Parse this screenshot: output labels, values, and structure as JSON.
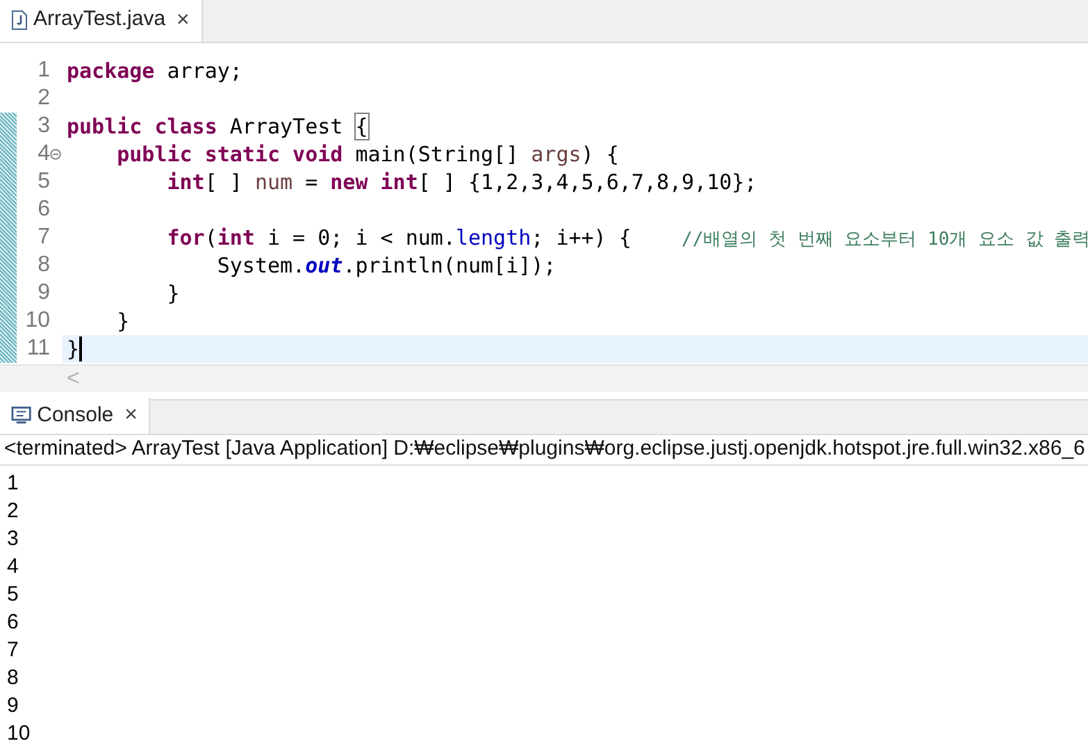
{
  "editor_tab": {
    "title": "ArrayTest.java",
    "close": "×"
  },
  "editor": {
    "lines": [
      {
        "number": "1",
        "changed": false,
        "current": false,
        "fold": false,
        "tokens": [
          {
            "kind": "keyword",
            "text": "package"
          },
          {
            "kind": "plain",
            "text": " array;"
          }
        ]
      },
      {
        "number": "2",
        "changed": false,
        "current": false,
        "fold": false
      },
      {
        "number": "3",
        "changed": true,
        "current": false,
        "fold": false,
        "tokens": [
          {
            "kind": "keyword",
            "text": "public"
          },
          {
            "kind": "keyword",
            "text": " class"
          },
          {
            "kind": "plain",
            "text": " ArrayTest "
          },
          {
            "kind": "matched_bracket",
            "text": "{"
          }
        ]
      },
      {
        "number": "4",
        "changed": true,
        "current": false,
        "fold": true,
        "tokens": [
          {
            "kind": "keyword",
            "text": "    public"
          },
          {
            "kind": "keyword",
            "text": " static"
          },
          {
            "kind": "keyword",
            "text": " void"
          },
          {
            "kind": "plain",
            "text": " main(String[] "
          },
          {
            "kind": "variable",
            "text": "args"
          },
          {
            "kind": "plain",
            "text": ") {"
          }
        ]
      },
      {
        "number": "5",
        "changed": true,
        "current": false,
        "fold": false,
        "tokens": [
          {
            "kind": "keyword",
            "text": "        int"
          },
          {
            "kind": "plain",
            "text": "[ ] "
          },
          {
            "kind": "variable",
            "text": "num"
          },
          {
            "kind": "plain",
            "text": " = "
          },
          {
            "kind": "keyword",
            "text": "new"
          },
          {
            "kind": "keyword",
            "text": " int"
          },
          {
            "kind": "plain",
            "text": "[ ] {1,2,3,4,5,6,7,8,9,10};"
          }
        ]
      },
      {
        "number": "6",
        "changed": true,
        "current": false,
        "fold": false
      },
      {
        "number": "7",
        "changed": true,
        "current": false,
        "fold": false,
        "tokens": [
          {
            "kind": "keyword",
            "text": "        for"
          },
          {
            "kind": "plain",
            "text": "("
          },
          {
            "kind": "keyword",
            "text": "int"
          },
          {
            "kind": "plain",
            "text": " i = 0; i < num."
          },
          {
            "kind": "field",
            "text": "length"
          },
          {
            "kind": "plain",
            "text": "; i++) {    "
          },
          {
            "kind": "comment",
            "text": "//배열의 첫 번째 요소부터 10개 요소 값 출력"
          }
        ]
      },
      {
        "number": "8",
        "changed": true,
        "current": false,
        "fold": false,
        "tokens": [
          {
            "kind": "plain",
            "text": "            System."
          },
          {
            "kind": "static_field",
            "text": "out"
          },
          {
            "kind": "plain",
            "text": ".println(num[i]);"
          }
        ]
      },
      {
        "number": "9",
        "changed": true,
        "current": false,
        "fold": false,
        "tokens": [
          {
            "kind": "plain",
            "text": "        }"
          }
        ]
      },
      {
        "number": "10",
        "changed": true,
        "current": false,
        "fold": false,
        "tokens": [
          {
            "kind": "plain",
            "text": "    }"
          }
        ]
      },
      {
        "number": "11",
        "changed": true,
        "current": true,
        "fold": false,
        "tokens": [
          {
            "kind": "plain",
            "text": "}"
          }
        ]
      }
    ],
    "scroll_left": "<"
  },
  "console_tab": {
    "title": "Console",
    "close": "×"
  },
  "console": {
    "header": "<terminated> ArrayTest [Java Application] D:₩eclipse₩plugins₩org.eclipse.justj.openjdk.hotspot.jre.full.win32.x86_6",
    "output": [
      "1",
      "2",
      "3",
      "4",
      "5",
      "6",
      "7",
      "8",
      "9",
      "10"
    ]
  }
}
